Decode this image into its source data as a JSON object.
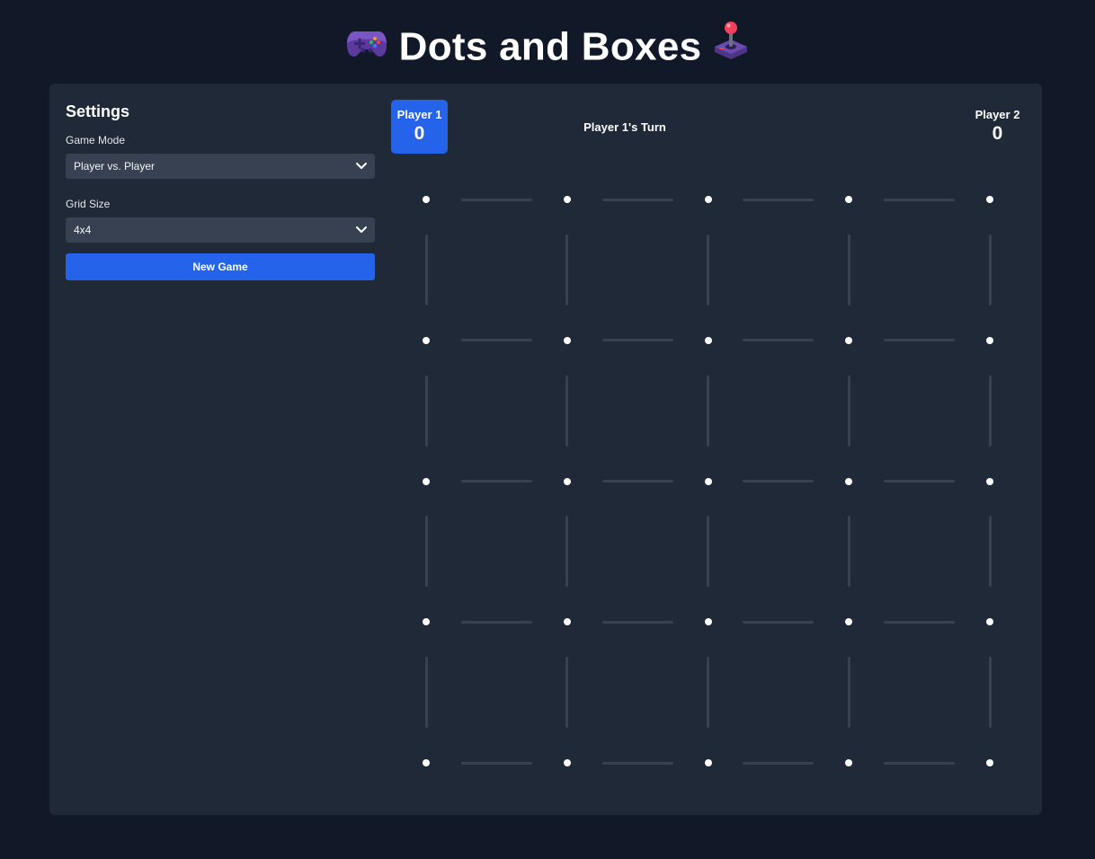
{
  "header": {
    "title": "Dots and Boxes",
    "left_emoji": "gamepad-icon",
    "right_emoji": "joystick-icon"
  },
  "settings": {
    "title": "Settings",
    "game_mode_label": "Game Mode",
    "game_mode_value": "Player vs. Player",
    "grid_size_label": "Grid Size",
    "grid_size_value": "4x4",
    "new_game_label": "New Game"
  },
  "scoreboard": {
    "player1_name": "Player 1",
    "player1_score": "0",
    "player2_name": "Player 2",
    "player2_score": "0",
    "turn_text": "Player 1's Turn",
    "active_player": 1
  },
  "board": {
    "grid_size": 4,
    "drawn_lines": 0
  },
  "colors": {
    "page_bg": "#111827",
    "card_bg": "#1f2937",
    "accent": "#2563eb",
    "line_idle": "#374151",
    "dot": "#ffffff"
  }
}
